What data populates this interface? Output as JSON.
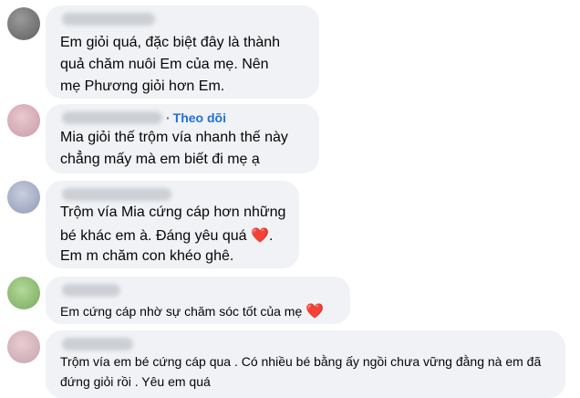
{
  "colors": {
    "bubble": "#f0f2f5",
    "follow_link": "#216fdb",
    "heart": "#e0245e"
  },
  "comments": [
    {
      "lines": [
        "Em giỏi quá, đặc biệt đây là thành",
        "quả chăm nuôi Em của mẹ. Nên",
        "mẹ Phương giỏi hơn Em."
      ]
    },
    {
      "follow_label": "Theo dõi",
      "lines": [
        "Mia giỏi thế trộm vía nhanh thế này",
        "chẳng mấy mà em biết đi mẹ ạ"
      ]
    },
    {
      "lines": [
        "Trộm vía Mia cứng cáp hơn những",
        "bé khác em à. Đáng yêu quá",
        ".",
        "Em m chăm con khéo ghê."
      ],
      "emoji": "heart-emoji"
    },
    {
      "lines": [
        "Em cứng cáp nhờ sự chăm sóc tốt của mẹ"
      ],
      "emoji": "heart-emoji"
    },
    {
      "lines": [
        "Trộm vía em bé cứng cáp qua . Có nhiều bé bằng ấy ngồi chưa vững đằng nà em đã",
        "đứng giỏi rồi . Yêu em quá"
      ]
    }
  ]
}
